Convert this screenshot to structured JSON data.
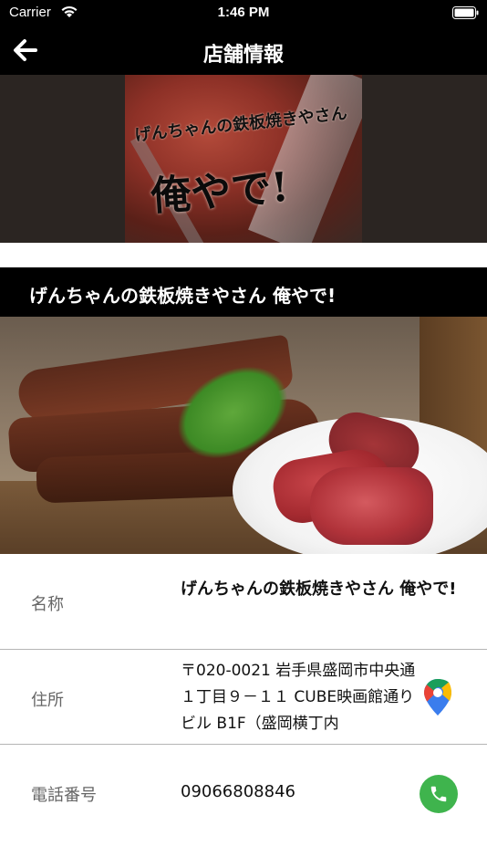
{
  "status_bar": {
    "carrier": "Carrier",
    "time": "1:46 PM"
  },
  "nav": {
    "title": "店舗情報",
    "back_icon": "arrow-left-icon"
  },
  "banner": {
    "logo_line1": "げんちゃんの鉄板焼きやさん",
    "logo_line2": "俺やで!"
  },
  "shop": {
    "title": "げんちゃんの鉄板焼きやさん 俺やで!"
  },
  "info": {
    "name_label": "名称",
    "name_value": "げんちゃんの鉄板焼きやさん 俺やで!",
    "address_label": "住所",
    "address_value": "〒020-0021 岩手県盛岡市中央通１丁目９－１１ CUBE映画館通りビル B1F（盛岡横丁内",
    "phone_label": "電話番号",
    "phone_value": "09066808846",
    "map_icon": "google-maps-pin-icon",
    "phone_icon": "phone-call-icon"
  },
  "colors": {
    "bar_background": "#000000",
    "phone_button": "#3fb44d",
    "label_text": "#666666"
  }
}
